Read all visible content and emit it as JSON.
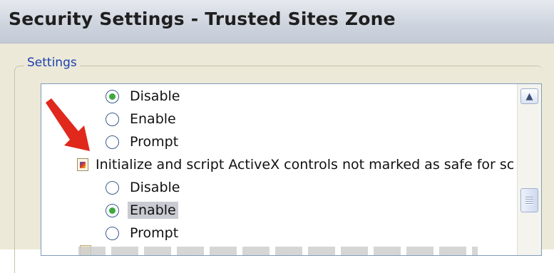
{
  "window": {
    "title": "Security Settings - Trusted Sites Zone"
  },
  "settings_group": {
    "label": "Settings"
  },
  "list": {
    "items": [
      {
        "type": "option",
        "label": "Disable",
        "selected": true
      },
      {
        "type": "option",
        "label": "Enable",
        "selected": false
      },
      {
        "type": "option",
        "label": "Prompt",
        "selected": false
      },
      {
        "type": "setting",
        "label": "Initialize and script ActiveX controls not marked as safe for sc",
        "icon": "activex-setting-icon"
      },
      {
        "type": "option",
        "label": "Disable",
        "selected": false
      },
      {
        "type": "option",
        "label": "Enable",
        "selected": true,
        "highlighted": true
      },
      {
        "type": "option",
        "label": "Prompt",
        "selected": false
      }
    ]
  },
  "scrollbar": {
    "up_icon": "chevron-up-icon",
    "thumb_icon": "scroll-grip-icon"
  },
  "annotation": {
    "icon": "red-arrow-icon",
    "color": "#e0281c"
  }
}
